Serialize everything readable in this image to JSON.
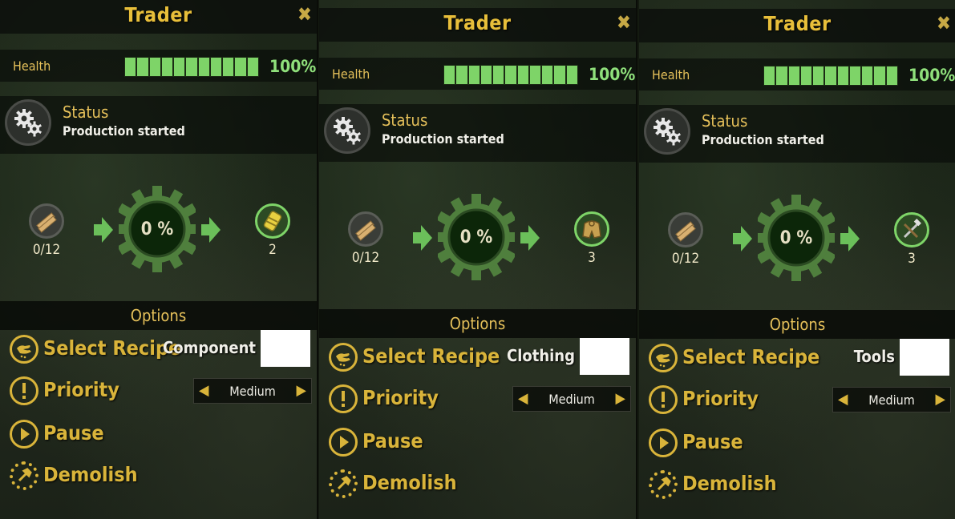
{
  "panels": [
    {
      "title": "Trader",
      "health_label": "Health",
      "health_value": "100%",
      "health_fill": 1.0,
      "status_title": "Status",
      "status_text": "Production started",
      "input_count": "0/12",
      "progress": "0 %",
      "output_count": "2",
      "output_icon": "component-icon",
      "options_title": "Options",
      "select_recipe": "Select Recipe",
      "recipe_name": "Component",
      "priority_label": "Priority",
      "priority_value": "Medium",
      "pause_label": "Pause",
      "demolish_label": "Demolish"
    },
    {
      "title": "Trader",
      "health_label": "Health",
      "health_value": "100%",
      "health_fill": 1.0,
      "status_title": "Status",
      "status_text": "Production started",
      "input_count": "0/12",
      "progress": "0 %",
      "output_count": "3",
      "output_icon": "clothing-icon",
      "options_title": "Options",
      "select_recipe": "Select Recipe",
      "recipe_name": "Clothing",
      "priority_label": "Priority",
      "priority_value": "Medium",
      "pause_label": "Pause",
      "demolish_label": "Demolish"
    },
    {
      "title": "Trader",
      "health_label": "Health",
      "health_value": "100%",
      "health_fill": 1.0,
      "status_title": "Status",
      "status_text": "Production started",
      "input_count": "0/12",
      "progress": "0 %",
      "output_count": "3",
      "output_icon": "tools-icon",
      "options_title": "Options",
      "select_recipe": "Select Recipe",
      "recipe_name": "Tools",
      "priority_label": "Priority",
      "priority_value": "Medium",
      "pause_label": "Pause",
      "demolish_label": "Demolish"
    }
  ],
  "close_icon": "close-icon",
  "colors": {
    "accent": "#e5c05a",
    "health": "#7ed468",
    "option_gold": "#d9b43a"
  }
}
